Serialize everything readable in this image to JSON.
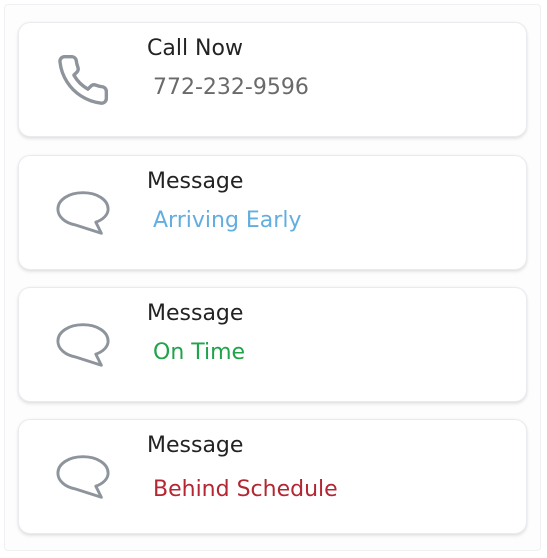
{
  "contacts": [
    {
      "title": "Call Now",
      "subtitle": "772-232-9596",
      "subtitle_color": "#6a6a6a",
      "icon": "phone-icon"
    },
    {
      "title": "Message",
      "subtitle": "Arriving Early",
      "subtitle_color": "#63aee0",
      "icon": "chat-bubble-icon"
    },
    {
      "title": "Message",
      "subtitle": "On Time",
      "subtitle_color": "#21a34a",
      "icon": "chat-bubble-icon"
    },
    {
      "title": "Message",
      "subtitle": "Behind Schedule",
      "subtitle_color": "#b32632",
      "icon": "chat-bubble-icon"
    }
  ],
  "icon_color": "#8e949c"
}
